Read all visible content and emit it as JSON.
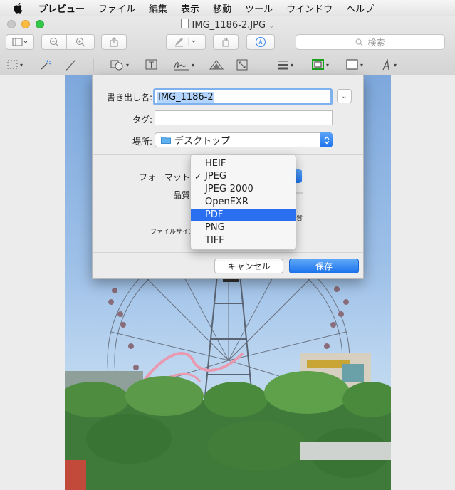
{
  "menubar": {
    "app_name": "プレビュー",
    "items": [
      "ファイル",
      "編集",
      "表示",
      "移動",
      "ツール",
      "ウインドウ",
      "ヘルプ"
    ]
  },
  "window": {
    "title": "IMG_1186-2.JPG",
    "search_placeholder": "検索"
  },
  "sheet": {
    "export_as_label": "書き出し名:",
    "export_as_value": "IMG_1186-2",
    "tags_label": "タグ:",
    "tags_value": "",
    "where_label": "場所:",
    "where_value": "デスクトップ",
    "format_label": "フォーマット",
    "quality_label": "品質",
    "quality_max_fragment": "質",
    "file_size_label": "ファイルサイズ",
    "cancel_label": "キャンセル",
    "save_label": "保存"
  },
  "format_menu": {
    "options": [
      "HEIF",
      "JPEG",
      "JPEG-2000",
      "OpenEXR",
      "PDF",
      "PNG",
      "TIFF"
    ],
    "checked": "JPEG",
    "highlighted": "PDF"
  },
  "colors": {
    "accent": "#2a6ff0",
    "selection": "#b3d4fc",
    "focus_ring": "#7fb1ef"
  }
}
